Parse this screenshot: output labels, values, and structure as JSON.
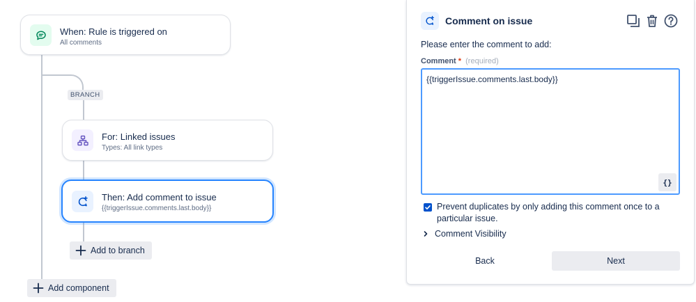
{
  "trigger": {
    "title": "When: Rule is triggered on",
    "subtitle": "All comments"
  },
  "branch_tag": "BRANCH",
  "branch": {
    "title": "For: Linked issues",
    "subtitle": "Types: All link types"
  },
  "action": {
    "title": "Then: Add comment to issue",
    "subtitle": "{{triggerIssue.comments.last.body}}"
  },
  "add_to_branch": "Add to branch",
  "add_component": "Add component",
  "panel": {
    "title": "Comment on issue",
    "prompt": "Please enter the comment to add:",
    "field_label": "Comment",
    "required_marker": "*",
    "required_text": "(required)",
    "comment_value": "{{triggerIssue.comments.last.body}}",
    "smart_value_button": "{}",
    "prevent_duplicates_label": "Prevent duplicates by only adding this comment once to a particular issue.",
    "prevent_duplicates_checked": true,
    "visibility_label": "Comment Visibility",
    "back_label": "Back",
    "next_label": "Next",
    "tools": [
      "copy-icon",
      "trash-icon",
      "help-icon"
    ]
  },
  "colors": {
    "accent": "#0052cc",
    "selected_border": "#2684ff",
    "trigger_icon_bg": "#e3fcef",
    "branch_icon_bg": "#f3f0ff"
  }
}
